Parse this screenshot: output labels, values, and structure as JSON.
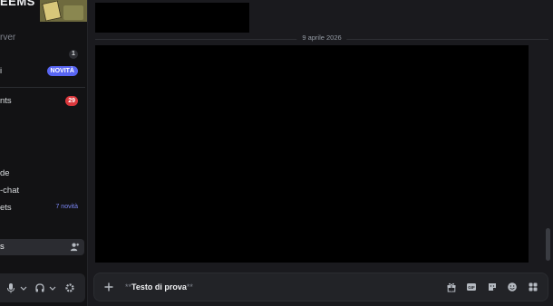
{
  "sidebar": {
    "guild_name": "EEMS",
    "server_tag": "rver",
    "items": [
      {
        "label": "",
        "badge": "1",
        "badge_type": "count"
      },
      {
        "label": "i",
        "badge": "NOVITÀ",
        "badge_type": "new"
      },
      {
        "label": "nts",
        "badge": "29",
        "badge_type": "red"
      },
      {
        "label": "de",
        "badge": "",
        "badge_type": ""
      },
      {
        "label": "-chat",
        "badge": "",
        "badge_type": ""
      },
      {
        "label": "ets",
        "badge": "7 novità",
        "badge_type": "link"
      },
      {
        "label": "s",
        "badge": "",
        "badge_type": "selected"
      }
    ]
  },
  "main": {
    "date_separator": "9 aprile 2026",
    "composer": {
      "prefix": "**",
      "bold_text": "Testo di prova",
      "suffix": "**"
    }
  },
  "colors": {
    "accent": "#5865f2",
    "alert": "#da373c",
    "background": "#1a1a1e",
    "sidebar": "#121214"
  },
  "icons": {
    "user_panel": [
      "microphone-icon",
      "chevron-down-icon",
      "headphones-icon",
      "chevron-down-icon",
      "gear-icon"
    ],
    "composer": [
      "plus-icon",
      "gift-icon",
      "gif-icon",
      "sticker-icon",
      "emoji-icon",
      "apps-icon"
    ]
  }
}
